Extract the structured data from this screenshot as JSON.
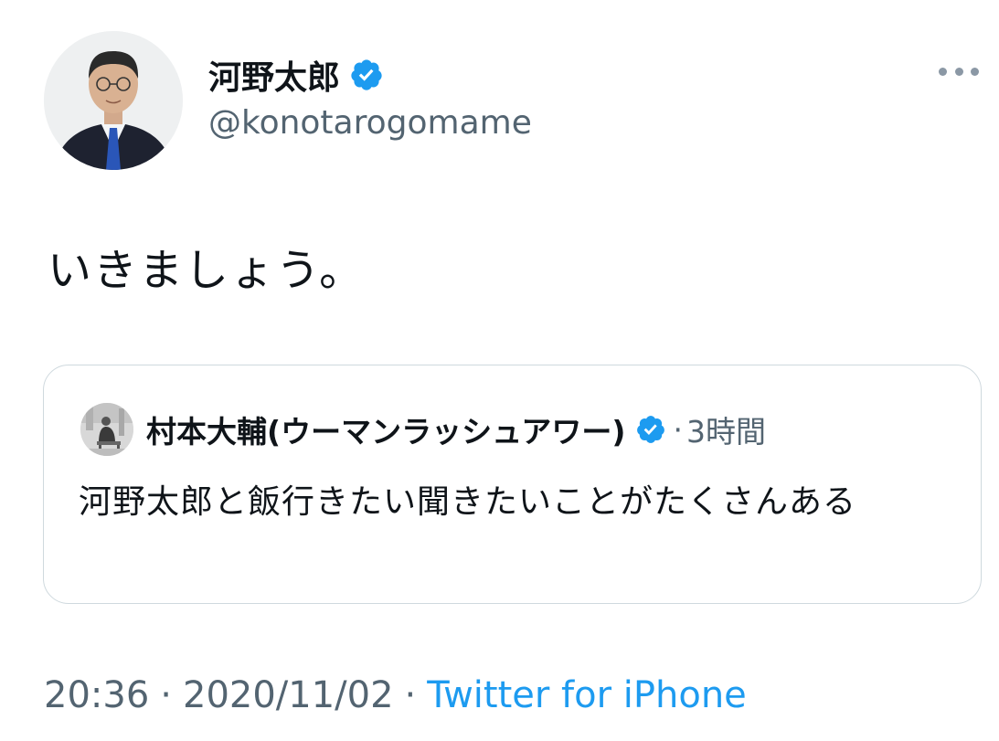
{
  "author": {
    "display_name": "河野太郎",
    "handle": "@konotarogomame",
    "verified": true,
    "avatar": "portrait-man-suit-icon"
  },
  "tweet": {
    "text": "いきましょう。"
  },
  "quoted_tweet": {
    "display_name": "村本大輔(ウーマンラッシュアワー)",
    "verified": true,
    "separator": "·",
    "time_ago": "3時間",
    "text": "河野太郎と飯行きたい聞きたいことがたくさんある",
    "avatar": "sitting-person-photo-icon"
  },
  "meta": {
    "time": "20:36",
    "dot1": "·",
    "date": "2020/11/02",
    "dot2": "·",
    "source": "Twitter for iPhone"
  },
  "colors": {
    "accent": "#1d9bf0",
    "text_primary": "#0f1419",
    "text_secondary": "#536471",
    "border": "#cfd9de"
  },
  "icons": {
    "verified": "verified-badge-icon",
    "more": "more-options-icon"
  }
}
